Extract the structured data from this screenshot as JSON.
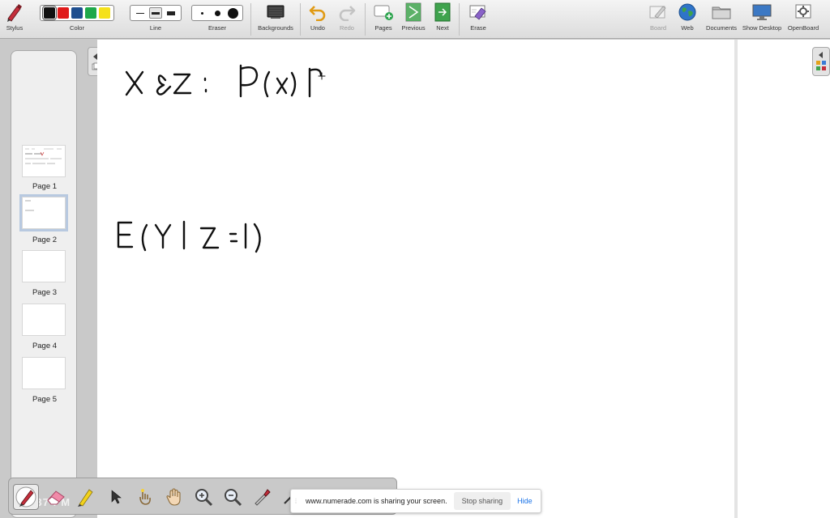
{
  "toolbar": {
    "stylus": "Stylus",
    "color": "Color",
    "line": "Line",
    "eraser": "Eraser",
    "backgrounds": "Backgrounds",
    "undo": "Undo",
    "redo": "Redo",
    "pages": "Pages",
    "previous": "Previous",
    "next": "Next",
    "erase": "Erase",
    "board": "Board",
    "web": "Web",
    "documents": "Documents",
    "show_desktop": "Show Desktop",
    "openboard": "OpenBoard",
    "colors": [
      "#111111",
      "#e01b1b",
      "#1f4f8f",
      "#1fa84a",
      "#f5e11a"
    ],
    "selected_color": "#111111"
  },
  "pages": {
    "items": [
      {
        "label": "Page 1",
        "selected": false
      },
      {
        "label": "Page 2",
        "selected": true
      },
      {
        "label": "Page 3",
        "selected": false
      },
      {
        "label": "Page 4",
        "selected": false
      },
      {
        "label": "Page 5",
        "selected": false
      }
    ]
  },
  "board": {
    "ink_color": "#111111",
    "handwriting": [
      "X & Z : P(X) P",
      "E(Y | Z = 1)"
    ]
  },
  "bottom_tools": {
    "icons": [
      "pen-icon",
      "eraser-icon",
      "highlighter-icon",
      "pointer-icon",
      "laser-pointer-icon",
      "hand-icon",
      "zoom-in-icon",
      "zoom-out-icon",
      "color-picker-icon",
      "line-icon"
    ],
    "clock": "8:37 PM"
  },
  "share_notice": {
    "text": "www.numerade.com is sharing your screen.",
    "stop": "Stop sharing",
    "hide": "Hide"
  }
}
